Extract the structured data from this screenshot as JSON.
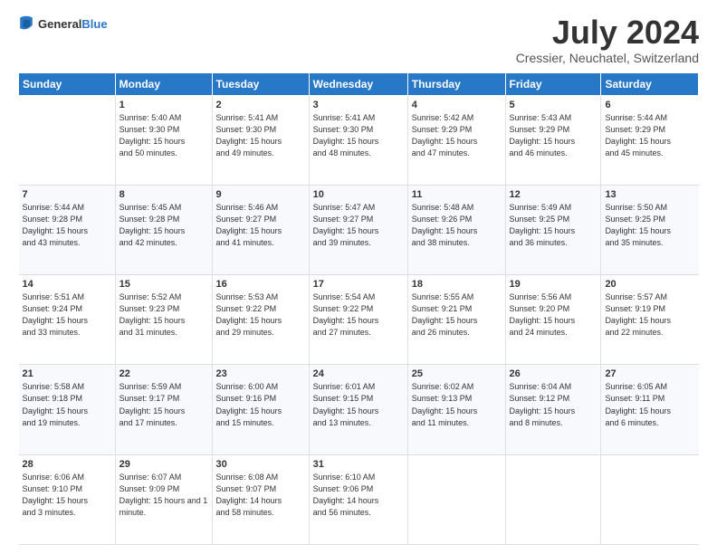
{
  "header": {
    "logo": {
      "general": "General",
      "blue": "Blue"
    },
    "title": "July 2024",
    "location": "Cressier, Neuchatel, Switzerland"
  },
  "weekdays": [
    "Sunday",
    "Monday",
    "Tuesday",
    "Wednesday",
    "Thursday",
    "Friday",
    "Saturday"
  ],
  "weeks": [
    [
      {
        "day": "",
        "sunrise": "",
        "sunset": "",
        "daylight": ""
      },
      {
        "day": "1",
        "sunrise": "Sunrise: 5:40 AM",
        "sunset": "Sunset: 9:30 PM",
        "daylight": "Daylight: 15 hours and 50 minutes."
      },
      {
        "day": "2",
        "sunrise": "Sunrise: 5:41 AM",
        "sunset": "Sunset: 9:30 PM",
        "daylight": "Daylight: 15 hours and 49 minutes."
      },
      {
        "day": "3",
        "sunrise": "Sunrise: 5:41 AM",
        "sunset": "Sunset: 9:30 PM",
        "daylight": "Daylight: 15 hours and 48 minutes."
      },
      {
        "day": "4",
        "sunrise": "Sunrise: 5:42 AM",
        "sunset": "Sunset: 9:29 PM",
        "daylight": "Daylight: 15 hours and 47 minutes."
      },
      {
        "day": "5",
        "sunrise": "Sunrise: 5:43 AM",
        "sunset": "Sunset: 9:29 PM",
        "daylight": "Daylight: 15 hours and 46 minutes."
      },
      {
        "day": "6",
        "sunrise": "Sunrise: 5:44 AM",
        "sunset": "Sunset: 9:29 PM",
        "daylight": "Daylight: 15 hours and 45 minutes."
      }
    ],
    [
      {
        "day": "7",
        "sunrise": "Sunrise: 5:44 AM",
        "sunset": "Sunset: 9:28 PM",
        "daylight": "Daylight: 15 hours and 43 minutes."
      },
      {
        "day": "8",
        "sunrise": "Sunrise: 5:45 AM",
        "sunset": "Sunset: 9:28 PM",
        "daylight": "Daylight: 15 hours and 42 minutes."
      },
      {
        "day": "9",
        "sunrise": "Sunrise: 5:46 AM",
        "sunset": "Sunset: 9:27 PM",
        "daylight": "Daylight: 15 hours and 41 minutes."
      },
      {
        "day": "10",
        "sunrise": "Sunrise: 5:47 AM",
        "sunset": "Sunset: 9:27 PM",
        "daylight": "Daylight: 15 hours and 39 minutes."
      },
      {
        "day": "11",
        "sunrise": "Sunrise: 5:48 AM",
        "sunset": "Sunset: 9:26 PM",
        "daylight": "Daylight: 15 hours and 38 minutes."
      },
      {
        "day": "12",
        "sunrise": "Sunrise: 5:49 AM",
        "sunset": "Sunset: 9:25 PM",
        "daylight": "Daylight: 15 hours and 36 minutes."
      },
      {
        "day": "13",
        "sunrise": "Sunrise: 5:50 AM",
        "sunset": "Sunset: 9:25 PM",
        "daylight": "Daylight: 15 hours and 35 minutes."
      }
    ],
    [
      {
        "day": "14",
        "sunrise": "Sunrise: 5:51 AM",
        "sunset": "Sunset: 9:24 PM",
        "daylight": "Daylight: 15 hours and 33 minutes."
      },
      {
        "day": "15",
        "sunrise": "Sunrise: 5:52 AM",
        "sunset": "Sunset: 9:23 PM",
        "daylight": "Daylight: 15 hours and 31 minutes."
      },
      {
        "day": "16",
        "sunrise": "Sunrise: 5:53 AM",
        "sunset": "Sunset: 9:22 PM",
        "daylight": "Daylight: 15 hours and 29 minutes."
      },
      {
        "day": "17",
        "sunrise": "Sunrise: 5:54 AM",
        "sunset": "Sunset: 9:22 PM",
        "daylight": "Daylight: 15 hours and 27 minutes."
      },
      {
        "day": "18",
        "sunrise": "Sunrise: 5:55 AM",
        "sunset": "Sunset: 9:21 PM",
        "daylight": "Daylight: 15 hours and 26 minutes."
      },
      {
        "day": "19",
        "sunrise": "Sunrise: 5:56 AM",
        "sunset": "Sunset: 9:20 PM",
        "daylight": "Daylight: 15 hours and 24 minutes."
      },
      {
        "day": "20",
        "sunrise": "Sunrise: 5:57 AM",
        "sunset": "Sunset: 9:19 PM",
        "daylight": "Daylight: 15 hours and 22 minutes."
      }
    ],
    [
      {
        "day": "21",
        "sunrise": "Sunrise: 5:58 AM",
        "sunset": "Sunset: 9:18 PM",
        "daylight": "Daylight: 15 hours and 19 minutes."
      },
      {
        "day": "22",
        "sunrise": "Sunrise: 5:59 AM",
        "sunset": "Sunset: 9:17 PM",
        "daylight": "Daylight: 15 hours and 17 minutes."
      },
      {
        "day": "23",
        "sunrise": "Sunrise: 6:00 AM",
        "sunset": "Sunset: 9:16 PM",
        "daylight": "Daylight: 15 hours and 15 minutes."
      },
      {
        "day": "24",
        "sunrise": "Sunrise: 6:01 AM",
        "sunset": "Sunset: 9:15 PM",
        "daylight": "Daylight: 15 hours and 13 minutes."
      },
      {
        "day": "25",
        "sunrise": "Sunrise: 6:02 AM",
        "sunset": "Sunset: 9:13 PM",
        "daylight": "Daylight: 15 hours and 11 minutes."
      },
      {
        "day": "26",
        "sunrise": "Sunrise: 6:04 AM",
        "sunset": "Sunset: 9:12 PM",
        "daylight": "Daylight: 15 hours and 8 minutes."
      },
      {
        "day": "27",
        "sunrise": "Sunrise: 6:05 AM",
        "sunset": "Sunset: 9:11 PM",
        "daylight": "Daylight: 15 hours and 6 minutes."
      }
    ],
    [
      {
        "day": "28",
        "sunrise": "Sunrise: 6:06 AM",
        "sunset": "Sunset: 9:10 PM",
        "daylight": "Daylight: 15 hours and 3 minutes."
      },
      {
        "day": "29",
        "sunrise": "Sunrise: 6:07 AM",
        "sunset": "Sunset: 9:09 PM",
        "daylight": "Daylight: 15 hours and 1 minute."
      },
      {
        "day": "30",
        "sunrise": "Sunrise: 6:08 AM",
        "sunset": "Sunset: 9:07 PM",
        "daylight": "Daylight: 14 hours and 58 minutes."
      },
      {
        "day": "31",
        "sunrise": "Sunrise: 6:10 AM",
        "sunset": "Sunset: 9:06 PM",
        "daylight": "Daylight: 14 hours and 56 minutes."
      },
      {
        "day": "",
        "sunrise": "",
        "sunset": "",
        "daylight": ""
      },
      {
        "day": "",
        "sunrise": "",
        "sunset": "",
        "daylight": ""
      },
      {
        "day": "",
        "sunrise": "",
        "sunset": "",
        "daylight": ""
      }
    ]
  ]
}
